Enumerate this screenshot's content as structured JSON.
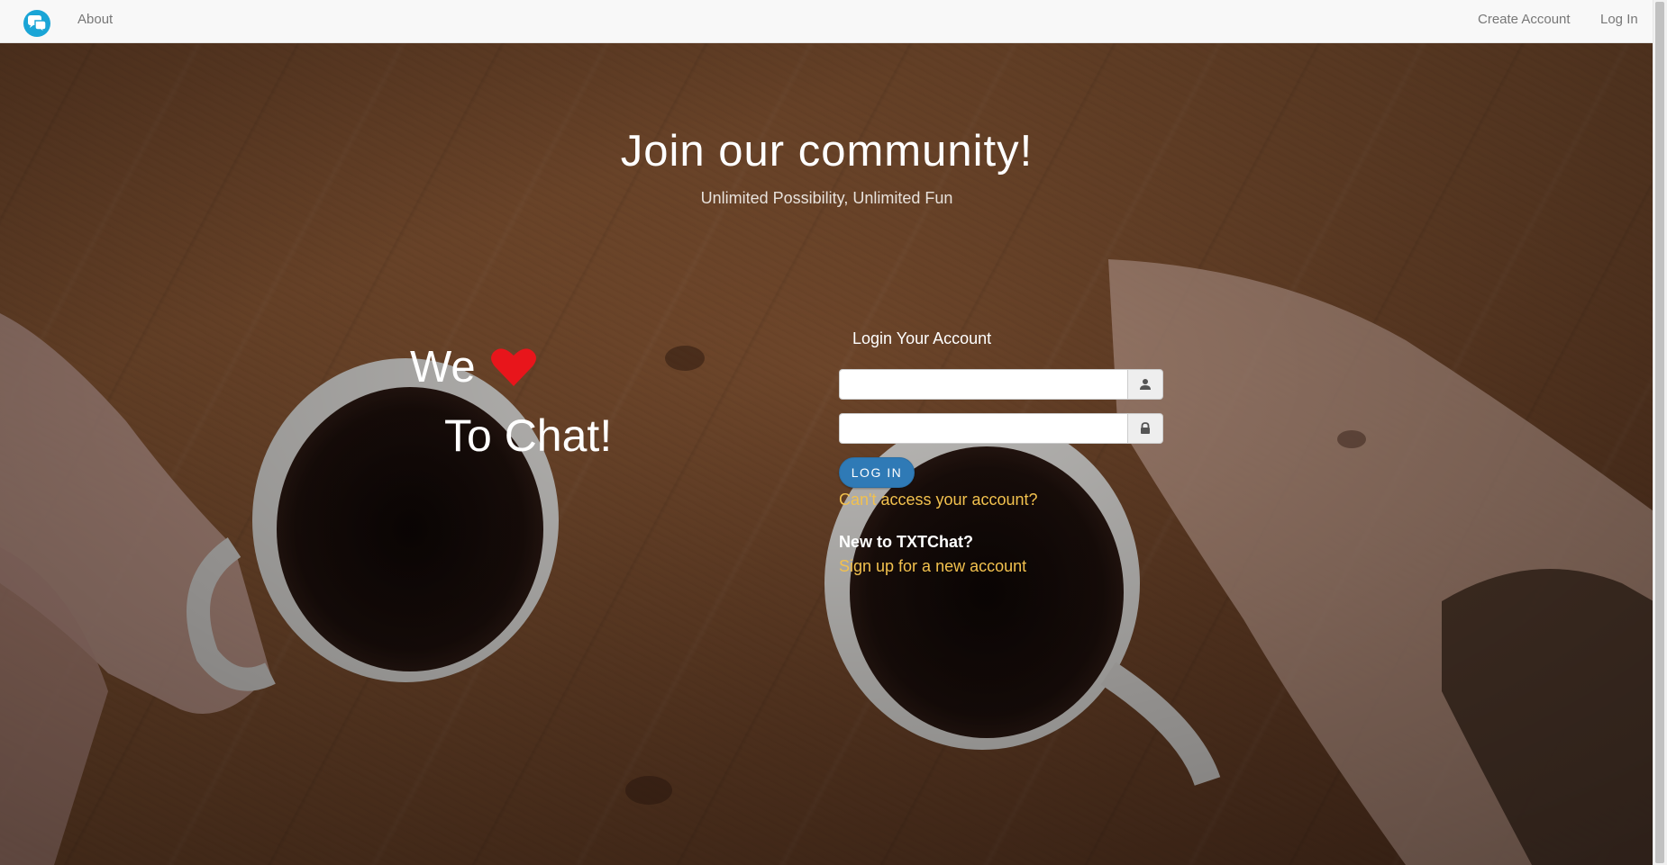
{
  "navbar": {
    "brand_icon": "chat-bubbles-icon",
    "about_label": "About",
    "create_account_label": "Create Account",
    "login_label": "Log In"
  },
  "hero": {
    "title": "Join our community!",
    "subtitle": "Unlimited Possibility, Unlimited Fun",
    "we_text": "We",
    "heart_icon": "heart-icon",
    "chat_text": "To Chat!"
  },
  "login": {
    "title": "Login Your Account",
    "username_icon": "user-icon",
    "username_value": "",
    "password_icon": "lock-icon",
    "password_value": "",
    "button_label": "Log in",
    "forgot_link": "Can't access your account?",
    "new_heading": "New to TXTChat?",
    "signup_link": "Sign up for a new account"
  },
  "colors": {
    "navbar_bg": "#f8f8f8",
    "brand_teal": "#1aa5d6",
    "button_blue": "#2f7ab6",
    "link_gold": "#f2c14e",
    "heart_red": "#e8151b"
  }
}
